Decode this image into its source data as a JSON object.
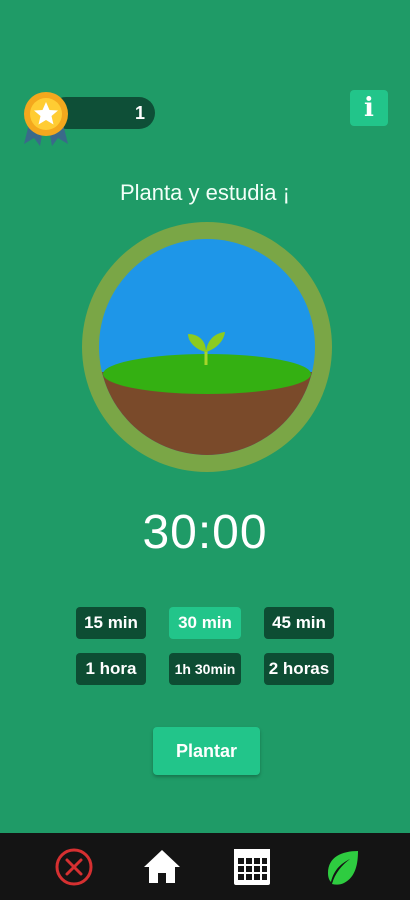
{
  "header": {
    "badge_count": "1",
    "info_label": "i"
  },
  "main": {
    "title": "Planta y estudia ¡",
    "timer": "30:00"
  },
  "durations": [
    {
      "label": "15 min",
      "selected": false
    },
    {
      "label": "30 min",
      "selected": true
    },
    {
      "label": "45 min",
      "selected": false
    },
    {
      "label": "1 hora",
      "selected": false
    },
    {
      "label": "1h 30min",
      "selected": false
    },
    {
      "label": "2 horas",
      "selected": false
    }
  ],
  "actions": {
    "plant_label": "Plantar"
  },
  "bottom_nav": [
    {
      "icon": "close-circle-icon"
    },
    {
      "icon": "home-icon"
    },
    {
      "icon": "calendar-grid-icon"
    },
    {
      "icon": "leaf-icon"
    }
  ],
  "colors": {
    "background": "#1f9b67",
    "accent": "#22c58a",
    "button_dark": "#0d4d33",
    "sky": "#1e96e8",
    "grass": "#34b012",
    "soil": "#7a4a2a",
    "ring": "#7aa646",
    "nav_close": "#d63031",
    "nav_leaf": "#2ecc40"
  }
}
